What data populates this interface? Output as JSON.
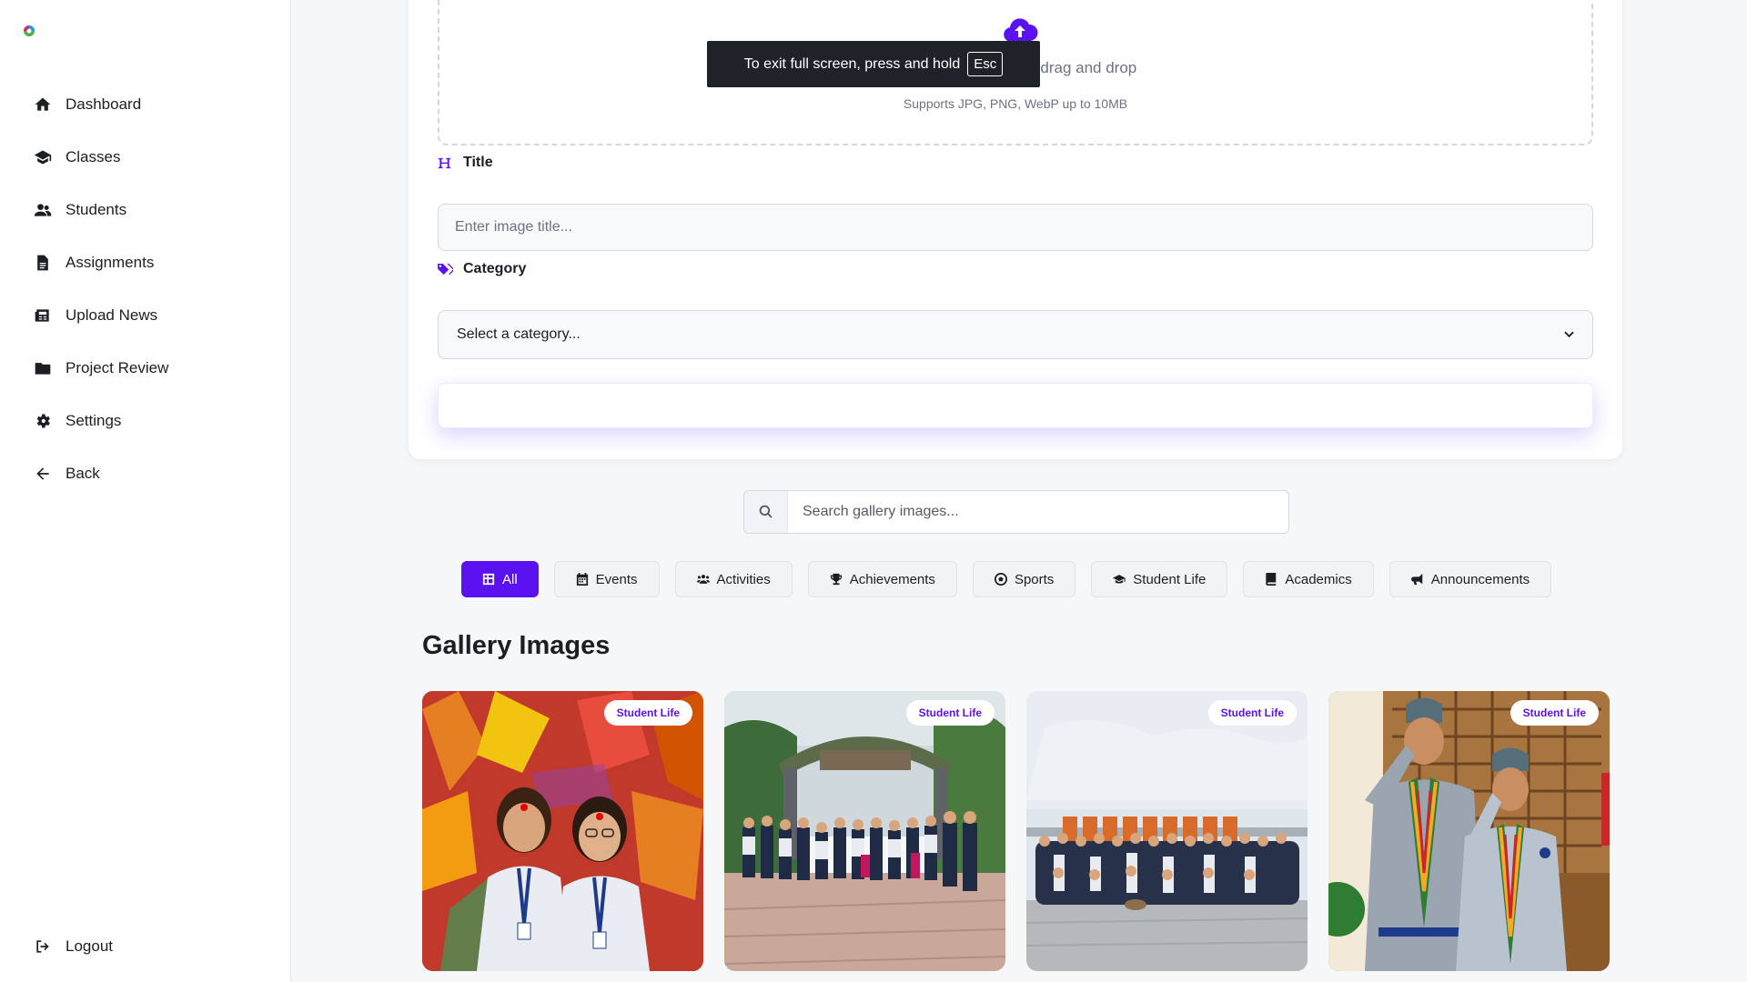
{
  "sidebar": {
    "items": [
      {
        "label": "Dashboard",
        "icon": "home-icon"
      },
      {
        "label": "Classes",
        "icon": "school-icon"
      },
      {
        "label": "Students",
        "icon": "users-icon"
      },
      {
        "label": "Assignments",
        "icon": "file-icon"
      },
      {
        "label": "Upload News",
        "icon": "newspaper-icon"
      },
      {
        "label": "Project Review",
        "icon": "folder-icon"
      },
      {
        "label": "Settings",
        "icon": "gear-icon"
      },
      {
        "label": "Back",
        "icon": "arrow-left-icon"
      }
    ],
    "logout": "Logout"
  },
  "upload": {
    "drag_text": "r drag and drop",
    "supports": "Supports JPG, PNG, WebP up to 10MB",
    "title_label": "Title",
    "title_placeholder": "Enter image title...",
    "category_label": "Category",
    "category_selected": "Select a category..."
  },
  "toast": {
    "text": "To exit full screen, press and hold",
    "key": "Esc"
  },
  "search": {
    "placeholder": "Search gallery images..."
  },
  "filters": [
    {
      "label": "All",
      "icon": "grid-icon",
      "active": true
    },
    {
      "label": "Events",
      "icon": "calendar-icon"
    },
    {
      "label": "Activities",
      "icon": "users-icon"
    },
    {
      "label": "Achievements",
      "icon": "trophy-icon"
    },
    {
      "label": "Sports",
      "icon": "ball-icon"
    },
    {
      "label": "Student Life",
      "icon": "graduation-cap-icon"
    },
    {
      "label": "Academics",
      "icon": "book-icon"
    },
    {
      "label": "Announcements",
      "icon": "megaphone-icon"
    }
  ],
  "gallery": {
    "title": "Gallery Images",
    "cards": [
      {
        "badge": "Student Life"
      },
      {
        "badge": "Student Life"
      },
      {
        "badge": "Student Life"
      },
      {
        "badge": "Student Life"
      }
    ]
  },
  "colors": {
    "accent": "#5b12f0",
    "sidebar_bg": "#ffffff",
    "main_bg": "#f6f7f9"
  }
}
